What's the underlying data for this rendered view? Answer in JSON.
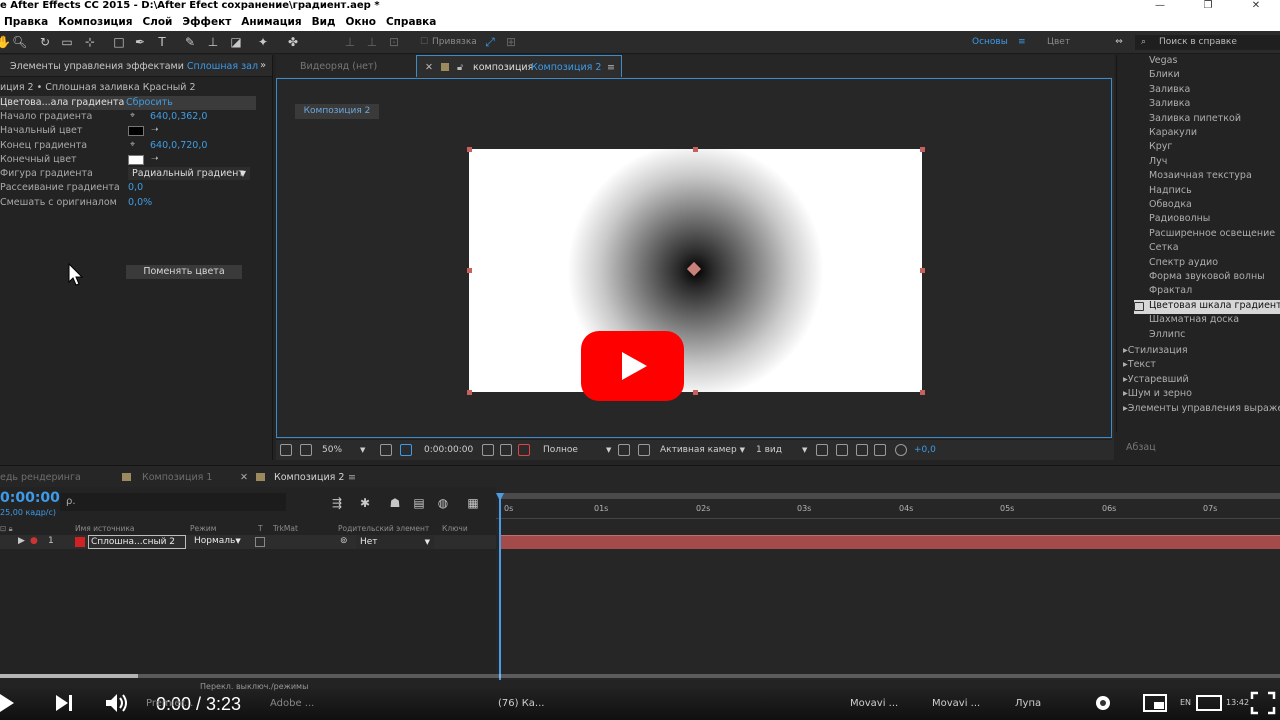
{
  "window": {
    "title": "e After Effects CC 2015 - D:\\After Efect сохранение\\градиент.aep *",
    "controls": [
      "—",
      "❐",
      "✕"
    ]
  },
  "menu": [
    "Правка",
    "Композиция",
    "Слой",
    "Эффект",
    "Анимация",
    "Вид",
    "Окно",
    "Справка"
  ],
  "toolbar": {
    "snap_label": "Привязка",
    "workspace_basic": "Основы",
    "workspace_color": "Цвет",
    "help_search_placeholder": "Поиск в справке"
  },
  "effect_controls": {
    "tab_label": "Элементы управления эффектами",
    "tab_layer": "Сплошная зал",
    "breadcrumb": "иция 2 • Сплошная заливка Красный 2",
    "effect_name": "Цветова...ала градиента",
    "reset_label": "Сбросить",
    "properties": [
      {
        "name": "Начало градиента",
        "value": "640,0,362,0"
      },
      {
        "name": "Начальный цвет",
        "value": ""
      },
      {
        "name": "Конец градиента",
        "value": "640,0,720,0"
      },
      {
        "name": "Конечный цвет",
        "value": ""
      },
      {
        "name": "Фигура градиента",
        "value": "Радиальный градиент"
      },
      {
        "name": "Рассеивание градиента",
        "value": "0,0"
      },
      {
        "name": "Смешать с оригиналом",
        "value": "0,0%"
      }
    ],
    "swap_button": "Поменять цвета"
  },
  "composition": {
    "tab_footage": "Видеоряд (нет)",
    "tab_prefix": "композиция",
    "tab_name": "Композиция 2",
    "subtab": "Композиция 2",
    "zoom": "50%",
    "timecode": "0:00:00:00",
    "resolution": "Полное",
    "camera": "Активная камер",
    "views": "1 вид",
    "exposure": "+0,0"
  },
  "presets": {
    "items": [
      "Vegas",
      "Блики",
      "Заливка",
      "Заливка",
      "Заливка пипеткой",
      "Каракули",
      "Круг",
      "Луч",
      "Мозаичная текстура",
      "Надпись",
      "Обводка",
      "Радиоволны",
      "Расширенное освещение",
      "Сетка",
      "Спектр аудио",
      "Форма звуковой волны",
      "Фрактал",
      "Цветовая шкала градиента",
      "Шахматная доска",
      "Эллипс"
    ],
    "selected_index": 17,
    "categories": [
      "Стилизация",
      "Текст",
      "Устаревший",
      "Шум и зерно",
      "Элементы управления выражениями"
    ],
    "paragraph_label": "Абзац"
  },
  "timeline": {
    "tabs": [
      "едь рендеринга",
      "Композиция 1",
      "Композиция 2"
    ],
    "timecode": "0:00:00",
    "fps": "25,00 кадр/с)",
    "search_placeholder": "ρ.",
    "columns": [
      "Имя источника",
      "Режим",
      "T",
      "TrkMat",
      "Родительский элемент",
      "Ключи"
    ],
    "layer": {
      "index": "1",
      "name": "Сплошна...сный 2",
      "mode": "Нормаль",
      "parent": "Нет"
    },
    "ruler_ticks": [
      "0s",
      "01s",
      "02s",
      "03s",
      "04s",
      "05s",
      "06s",
      "07s"
    ],
    "footer": "Перекл. выключ./режимы"
  },
  "player": {
    "current": "0:00",
    "duration": "3:23",
    "time_display": "0:00 / 3:23",
    "progress_fraction": 0.0
  },
  "taskbar": {
    "items": [
      "Premier...",
      "Adobe ...",
      "(76) Ка...",
      "Movavi ...",
      "Movavi ...",
      "Лупа"
    ],
    "lang": "EN",
    "clock": "13:42"
  },
  "colors": {
    "accent_blue": "#3d9be9",
    "youtube_red": "#ff0000",
    "layer_bar": "#a34a4a",
    "label_red": "#d02222"
  }
}
